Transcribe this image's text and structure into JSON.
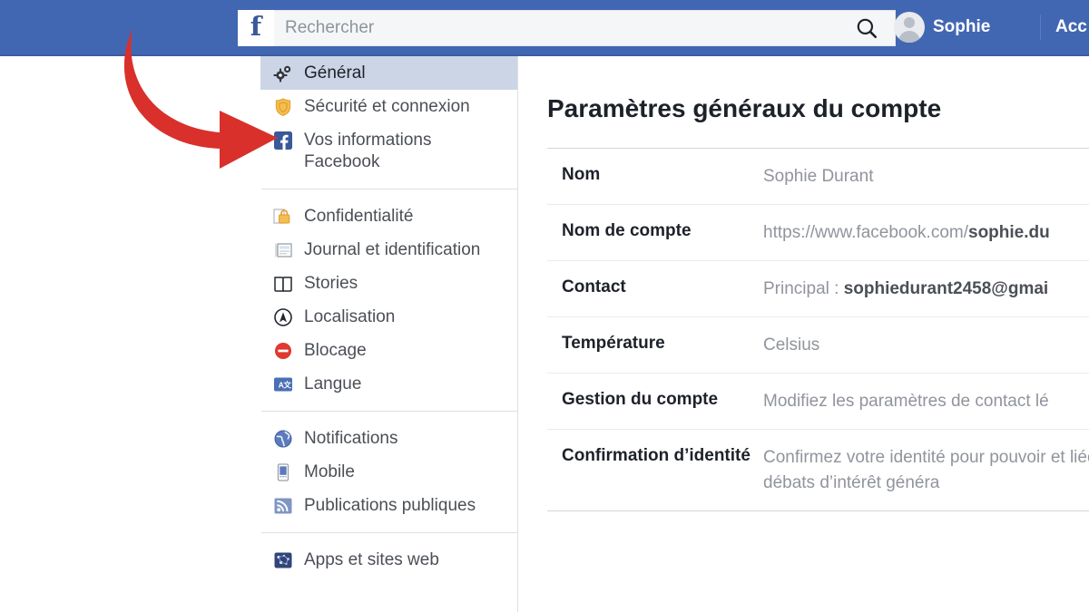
{
  "topbar": {
    "logo_letter": "f",
    "search_placeholder": "Rechercher",
    "search_value": "",
    "search_icon": "search-icon",
    "profile_name": "Sophie",
    "nav_link": "Acc"
  },
  "sidebar": {
    "groups": [
      {
        "items": [
          {
            "label": "Général",
            "icon": "gears-icon",
            "active": true
          },
          {
            "label": "Sécurité et connexion",
            "icon": "shield-icon",
            "active": false
          },
          {
            "label": "Vos informations Facebook",
            "icon": "facebook-icon",
            "active": false
          }
        ]
      },
      {
        "items": [
          {
            "label": "Confidentialité",
            "icon": "padlock-icon",
            "active": false
          },
          {
            "label": "Journal et identification",
            "icon": "timeline-icon",
            "active": false
          },
          {
            "label": "Stories",
            "icon": "book-icon",
            "active": false
          },
          {
            "label": "Localisation",
            "icon": "compass-icon",
            "active": false
          },
          {
            "label": "Blocage",
            "icon": "block-icon",
            "active": false
          },
          {
            "label": "Langue",
            "icon": "language-icon",
            "active": false
          }
        ]
      },
      {
        "items": [
          {
            "label": "Notifications",
            "icon": "globe-icon",
            "active": false
          },
          {
            "label": "Mobile",
            "icon": "phone-icon",
            "active": false
          },
          {
            "label": "Publications publiques",
            "icon": "rss-icon",
            "active": false
          }
        ]
      },
      {
        "items": [
          {
            "label": "Apps et sites web",
            "icon": "apps-icon",
            "active": false
          }
        ]
      }
    ]
  },
  "main": {
    "title": "Paramètres généraux du compte",
    "rows": [
      {
        "label": "Nom",
        "value": "Sophie Durant",
        "value_prefix": "",
        "value_bold": "",
        "wrap": false
      },
      {
        "label": "Nom de compte",
        "value": "",
        "value_prefix": "https://www.facebook.com/",
        "value_bold": "sophie.du",
        "wrap": false
      },
      {
        "label": "Contact",
        "value": "",
        "value_prefix": "Principal : ",
        "value_bold": "sophiedurant2458@gmai",
        "wrap": false
      },
      {
        "label": "Température",
        "value": "Celsius",
        "value_prefix": "",
        "value_bold": "",
        "wrap": false
      },
      {
        "label": "Gestion du compte",
        "value": "Modifiez les paramètres de contact lé",
        "value_prefix": "",
        "value_bold": "",
        "wrap": false
      },
      {
        "label": "Confirmation d’identité",
        "value": "Confirmez votre identité pour pouvoir et liées à des débats d’intérêt généra",
        "value_prefix": "",
        "value_bold": "",
        "wrap": true
      }
    ]
  },
  "annotation": {
    "arrow_color": "#d32f2f",
    "arrow_name": "red-arrow-pointing-to-general"
  },
  "colors": {
    "brand_blue": "#4267b2",
    "active_nav_bg": "#ccd5e6",
    "text_primary": "#1d2129",
    "text_muted": "#90949c"
  }
}
